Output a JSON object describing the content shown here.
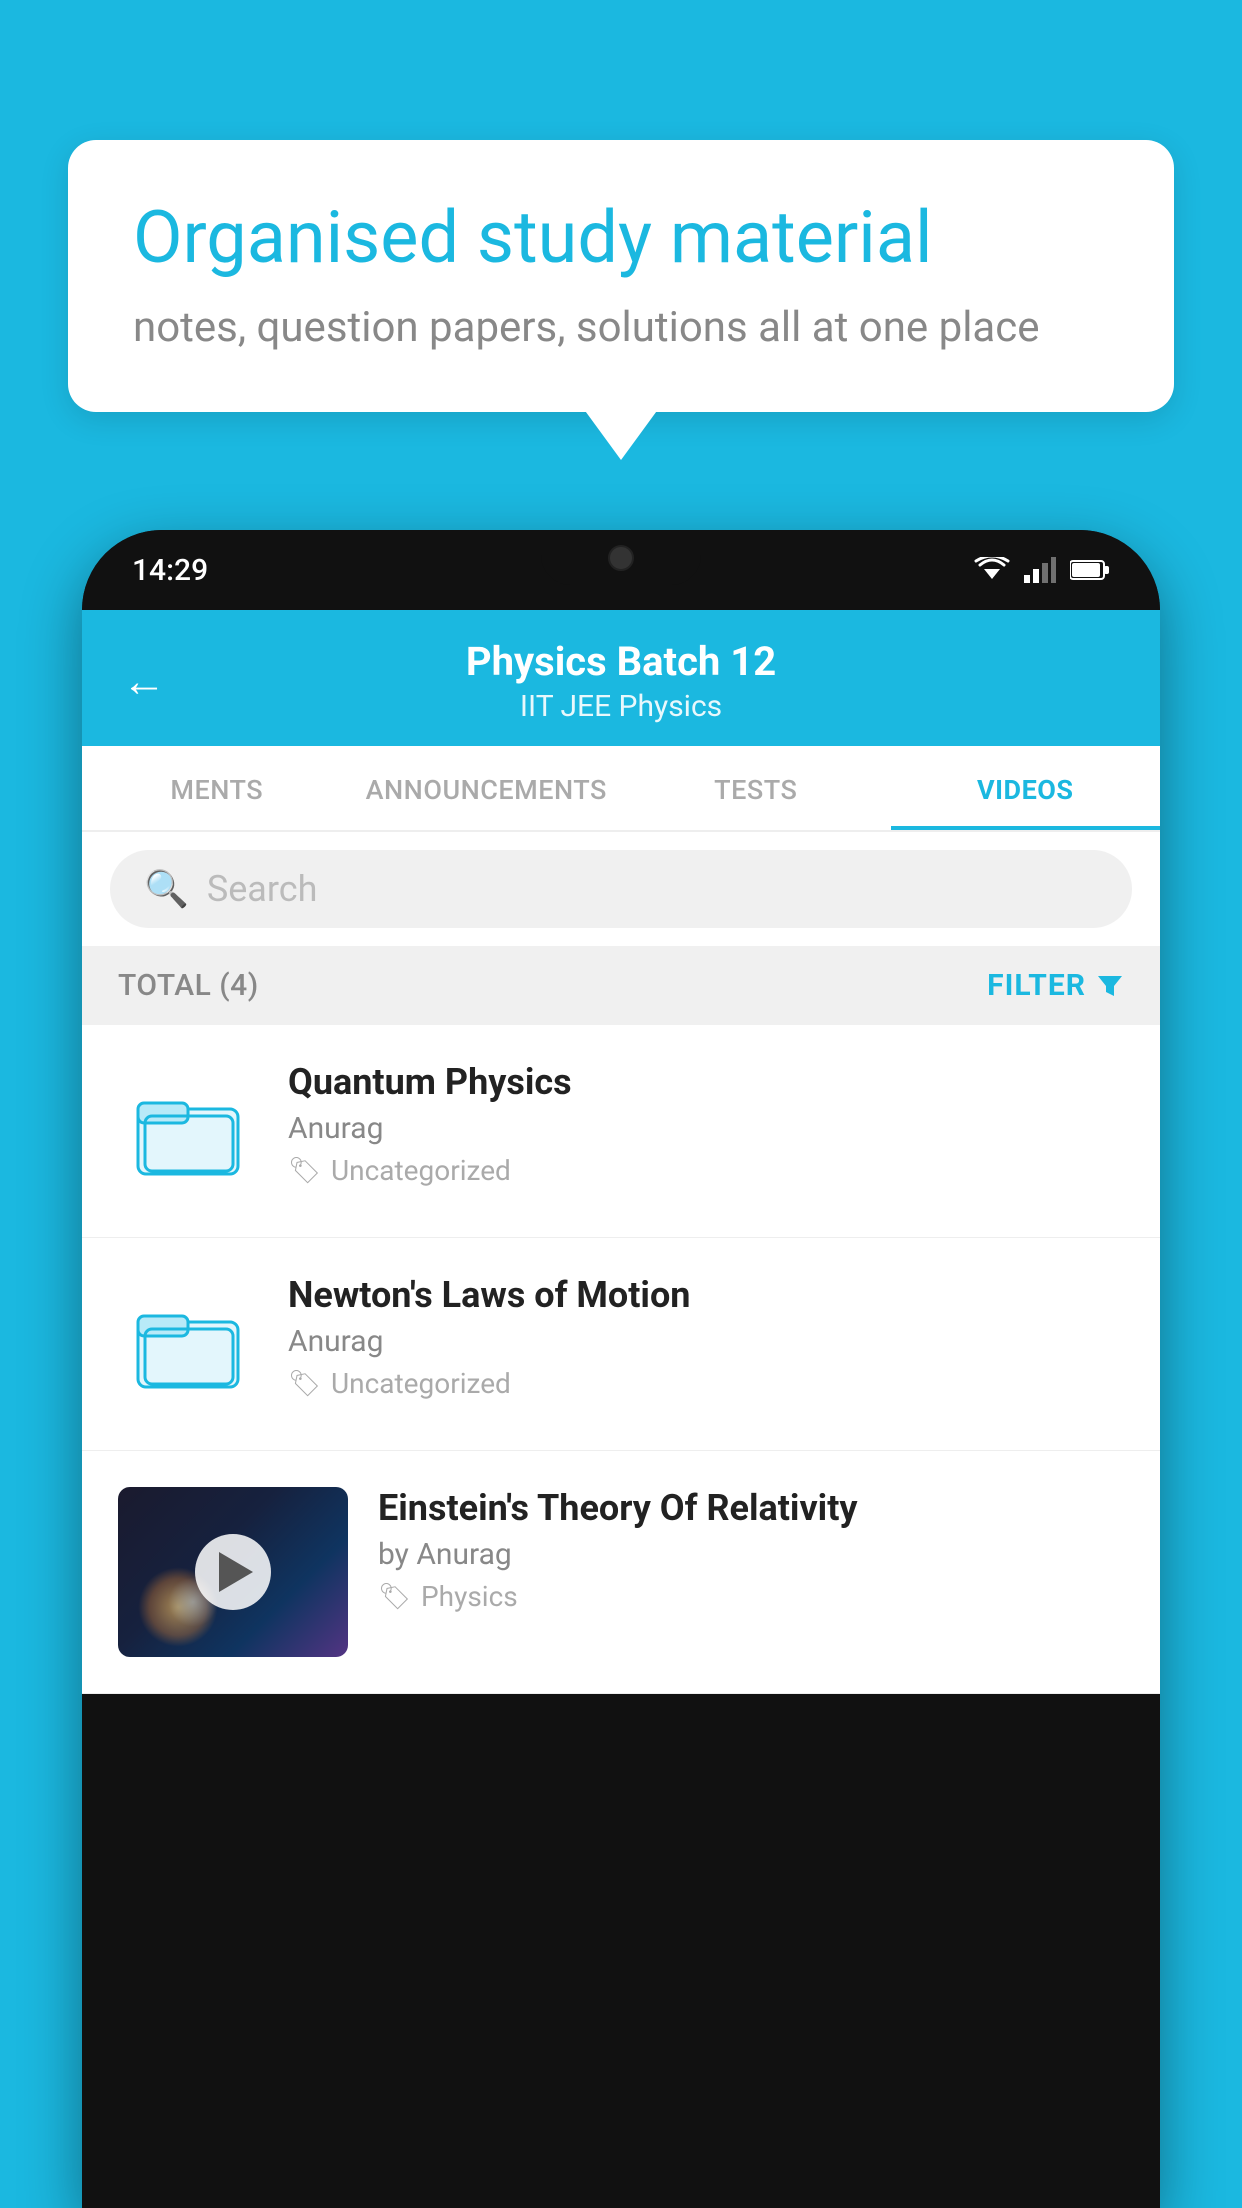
{
  "bubble": {
    "title": "Organised study material",
    "subtitle": "notes, question papers, solutions all at one place"
  },
  "status_bar": {
    "time": "14:29"
  },
  "header": {
    "title": "Physics Batch 12",
    "subtitle": "IIT JEE   Physics",
    "back_label": "←"
  },
  "tabs": [
    {
      "label": "MENTS",
      "active": false
    },
    {
      "label": "ANNOUNCEMENTS",
      "active": false
    },
    {
      "label": "TESTS",
      "active": false
    },
    {
      "label": "VIDEOS",
      "active": true
    }
  ],
  "search": {
    "placeholder": "Search"
  },
  "filter_bar": {
    "total_label": "TOTAL (4)",
    "filter_label": "FILTER"
  },
  "videos": [
    {
      "title": "Quantum Physics",
      "author": "Anurag",
      "tag": "Uncategorized",
      "has_thumb": false
    },
    {
      "title": "Newton's Laws of Motion",
      "author": "Anurag",
      "tag": "Uncategorized",
      "has_thumb": false
    },
    {
      "title": "Einstein's Theory Of Relativity",
      "author": "by Anurag",
      "tag": "Physics",
      "has_thumb": true
    }
  ]
}
